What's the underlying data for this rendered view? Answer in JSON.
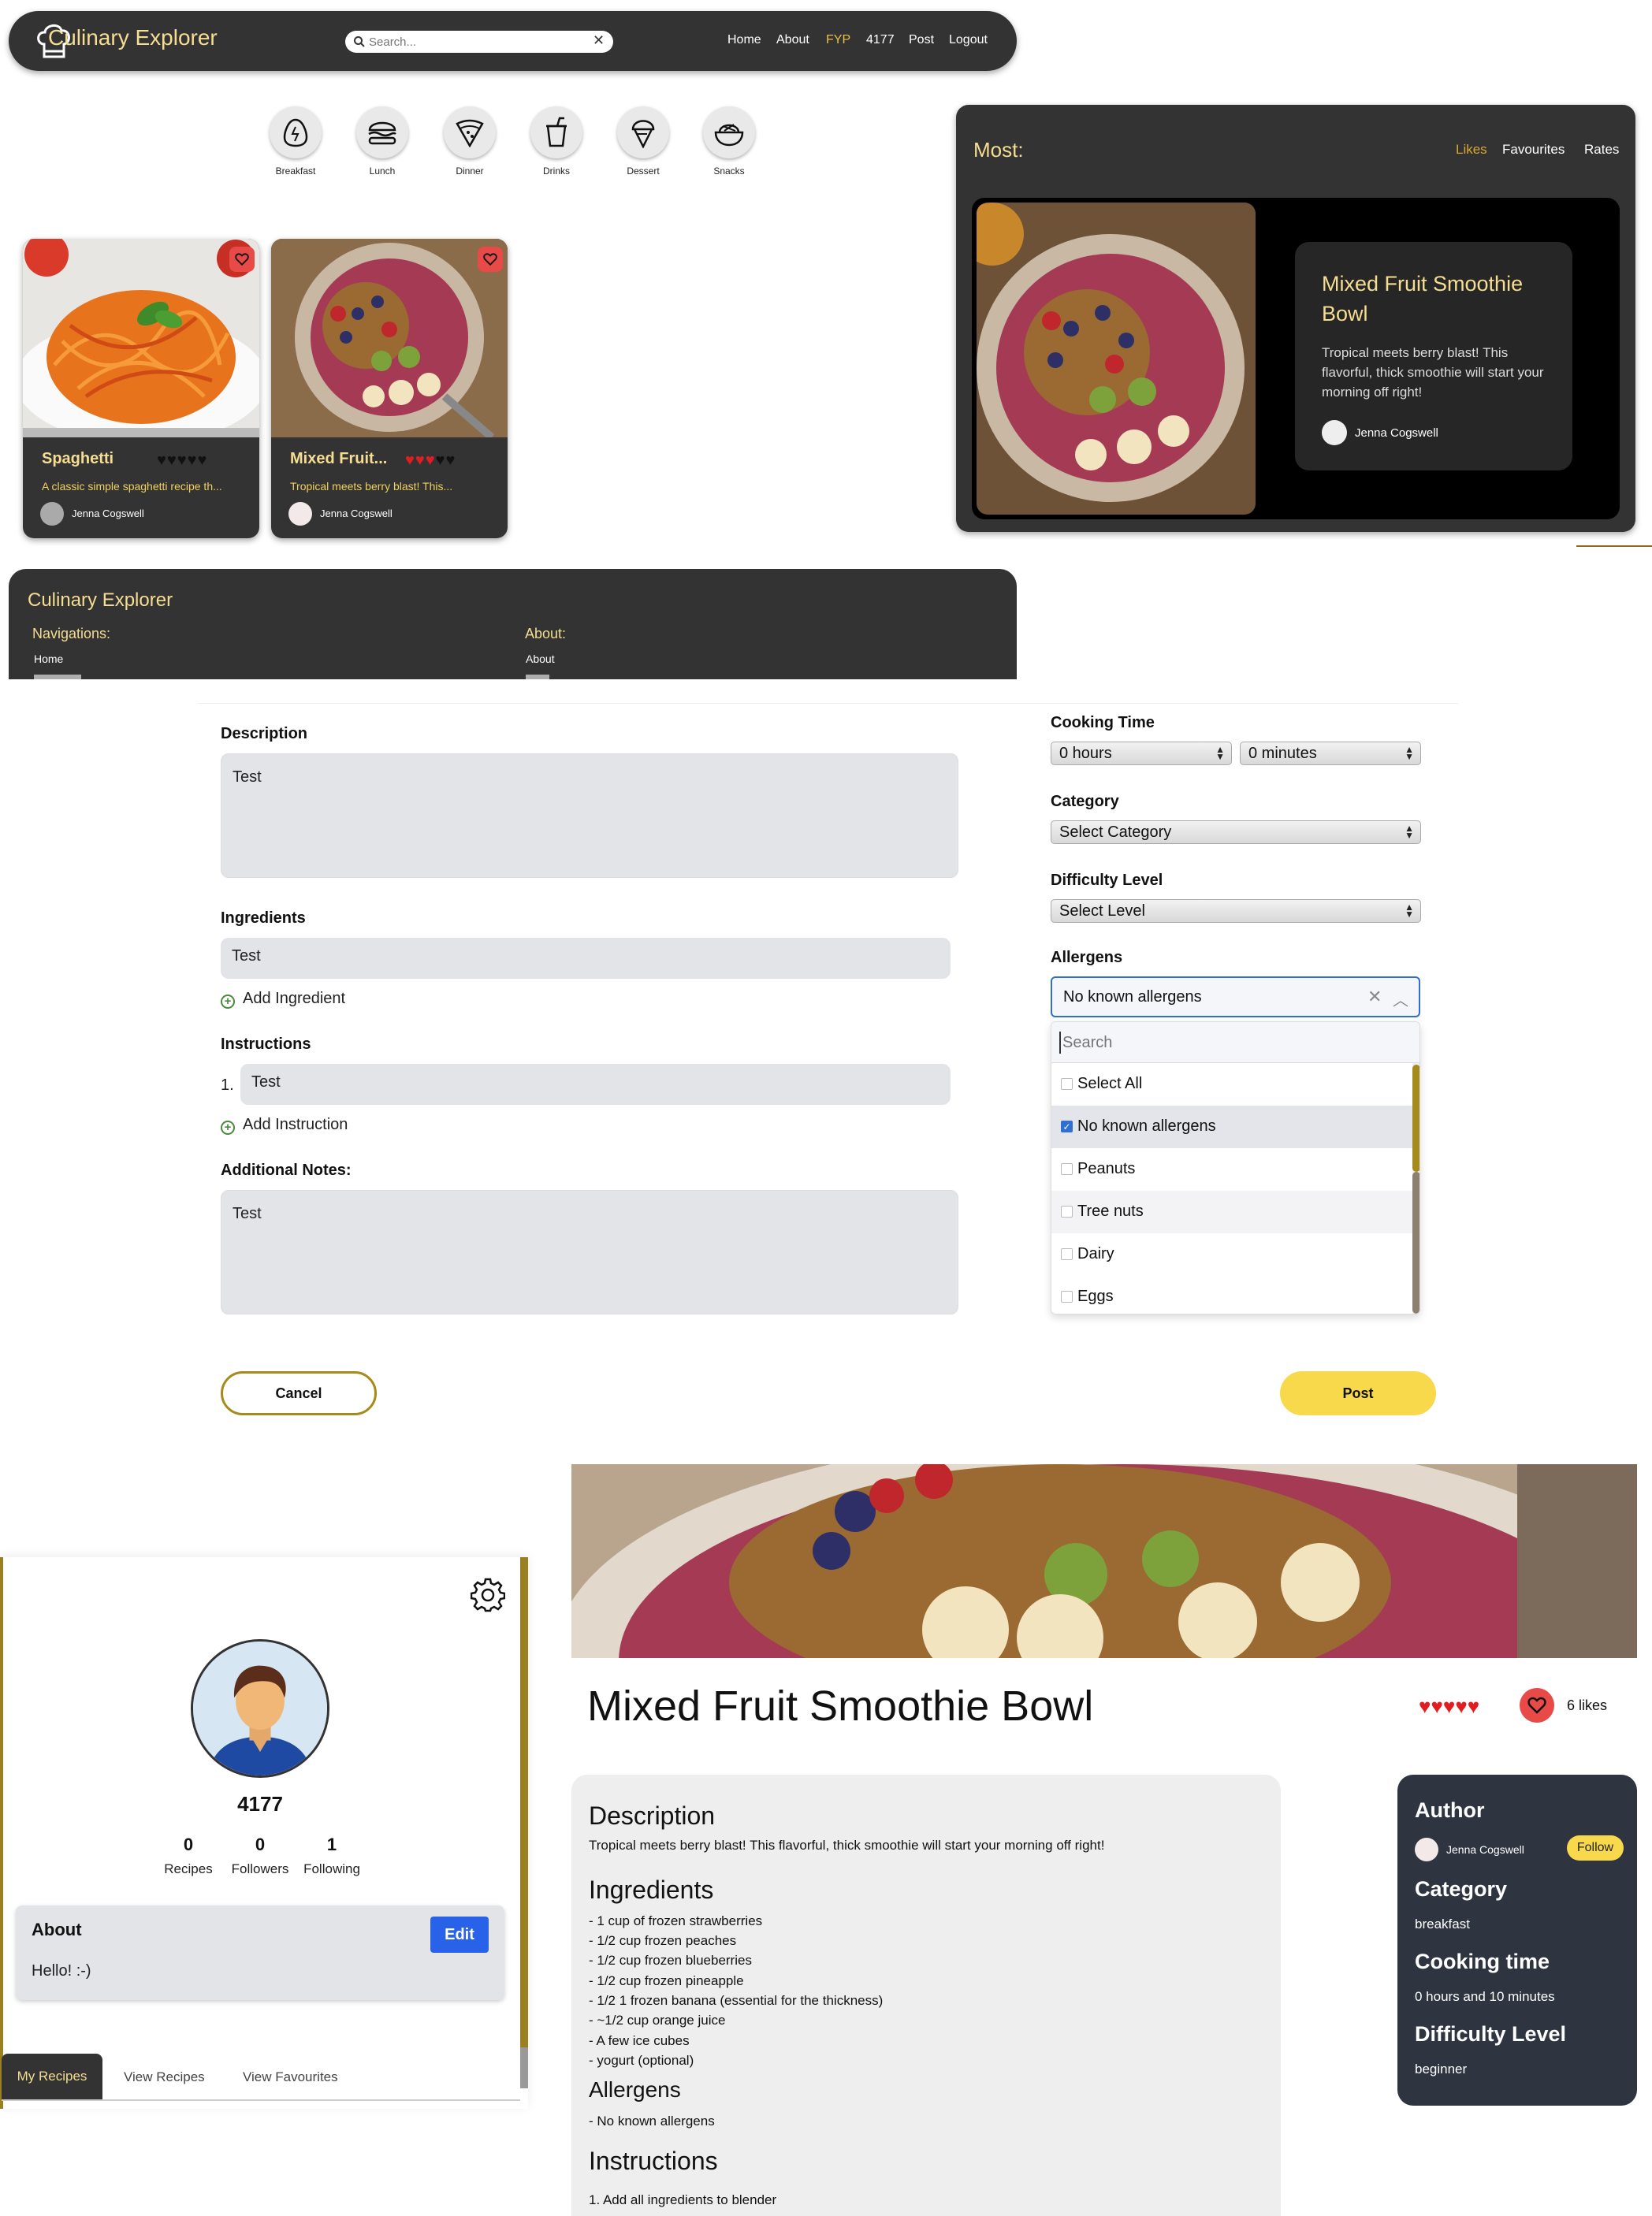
{
  "navbar": {
    "title": "Culinary Explorer",
    "search_placeholder": "Search...",
    "links": [
      "Home",
      "About",
      "FYP",
      "4177",
      "Post",
      "Logout"
    ],
    "active_link": "FYP"
  },
  "categories": [
    "Breakfast",
    "Lunch",
    "Dinner",
    "Drinks",
    "Dessert",
    "Snacks"
  ],
  "cards": [
    {
      "title": "Spaghetti",
      "stars": "♥♥♥♥♥",
      "description": "A classic simple spaghetti recipe th...",
      "author": "Jenna Cogswell"
    },
    {
      "title": "Mixed Fruit...",
      "stars_red": "♥♥♥",
      "stars_black": "♥♥",
      "description": "Tropical meets berry blast! This...",
      "author": "Jenna Cogswell"
    }
  ],
  "most": {
    "title": "Most:",
    "tabs": [
      "Likes",
      "Favourites",
      "Rates"
    ],
    "active_tab": "Likes",
    "featured": {
      "title": "Mixed Fruit Smoothie Bowl",
      "description": "Tropical meets berry blast! This flavorful, thick smoothie will start your morning off right!",
      "author": "Jenna Cogswell"
    }
  },
  "footer": {
    "title": "Culinary Explorer",
    "nav_heading": "Navigations:",
    "about_heading": "About:",
    "nav_link": "Home",
    "about_link": "About"
  },
  "form": {
    "description_label": "Description",
    "description_value": "Test",
    "ingredients_label": "Ingredients",
    "ingredient_value": "Test",
    "add_ingredient": "Add Ingredient",
    "instructions_label": "Instructions",
    "instruction_number": "1.",
    "instruction_value": "Test",
    "add_instruction": "Add Instruction",
    "notes_label": "Additional Notes:",
    "notes_value": "Test",
    "cooking_time_label": "Cooking Time",
    "hours_value": "0 hours",
    "minutes_value": "0 minutes",
    "category_label": "Category",
    "category_value": "Select Category",
    "difficulty_label": "Difficulty Level",
    "difficulty_value": "Select Level",
    "allergens_label": "Allergens",
    "allergens_value": "No known allergens",
    "allergens_search_placeholder": "Search",
    "allergen_options": [
      {
        "label": "Select All",
        "checked": false
      },
      {
        "label": "No known allergens",
        "checked": true
      },
      {
        "label": "Peanuts",
        "checked": false
      },
      {
        "label": "Tree nuts",
        "checked": false
      },
      {
        "label": "Dairy",
        "checked": false
      },
      {
        "label": "Eggs",
        "checked": false
      }
    ],
    "cancel_label": "Cancel",
    "post_label": "Post"
  },
  "profile": {
    "username": "4177",
    "stats": [
      {
        "value": "0",
        "label": "Recipes"
      },
      {
        "value": "0",
        "label": "Followers"
      },
      {
        "value": "1",
        "label": "Following"
      }
    ],
    "about_title": "About",
    "edit_label": "Edit",
    "about_text": "Hello! :-)",
    "tabs": [
      "My Recipes",
      "View Recipes",
      "View Favourites"
    ],
    "active_tab": "My Recipes"
  },
  "recipe": {
    "title": "Mixed Fruit Smoothie Bowl",
    "hearts": "♥♥♥♥♥",
    "likes": "6 likes",
    "description_heading": "Description",
    "description": "Tropical meets berry blast! This flavorful, thick smoothie will start your morning off right!",
    "ingredients_heading": "Ingredients",
    "ingredients": [
      "- 1 cup of frozen strawberries",
      "- 1/2 cup frozen peaches",
      "- 1/2 cup frozen blueberries",
      "- 1/2 cup frozen pineapple",
      "- 1/2 1 frozen banana (essential for the thickness)",
      "- ~1/2 cup orange juice",
      "- A few ice cubes",
      "- yogurt (optional)"
    ],
    "allergens_heading": "Allergens",
    "allergens": "- No known allergens",
    "instructions_heading": "Instructions",
    "instructions_first": "1. Add all ingredients to blender",
    "sidebar": {
      "author_heading": "Author",
      "author": "Jenna Cogswell",
      "follow_label": "Follow",
      "category_heading": "Category",
      "category": "breakfast",
      "cooking_heading": "Cooking time",
      "cooking": "0 hours and 10 minutes",
      "difficulty_heading": "Difficulty Level",
      "difficulty": "beginner"
    }
  },
  "colors": {
    "dark": "#333333",
    "accent_gold": "#f5dd91",
    "yellow_button": "#f8d94b",
    "heart_red": "#e11d22",
    "edit_blue": "#2862e8"
  }
}
